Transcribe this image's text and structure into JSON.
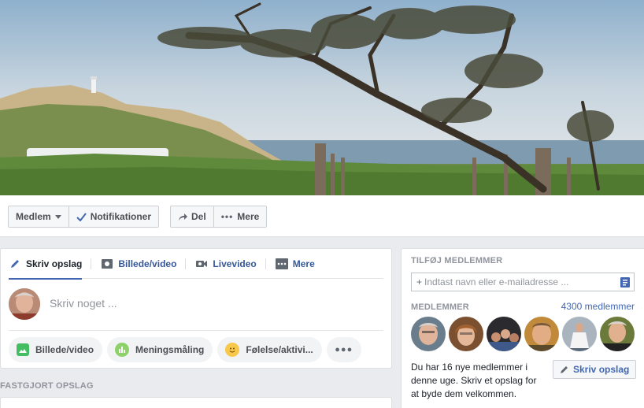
{
  "action_bar": {
    "member_label": "Medlem",
    "notifications_label": "Notifikationer",
    "share_label": "Del",
    "more_label": "Mere"
  },
  "composer": {
    "tabs": [
      {
        "label": "Skriv opslag",
        "icon": "pencil-icon"
      },
      {
        "label": "Billede/video",
        "icon": "photo-icon"
      },
      {
        "label": "Livevideo",
        "icon": "video-camera-icon"
      },
      {
        "label": "Mere",
        "icon": "more-dots-icon"
      }
    ],
    "placeholder": "Skriv noget ...",
    "pills": [
      {
        "label": "Billede/video",
        "icon": "photo-icon",
        "color": "#45bd62"
      },
      {
        "label": "Meningsmåling",
        "icon": "poll-icon",
        "color": "#8ed16b"
      },
      {
        "label": "Følelse/aktivi...",
        "icon": "smiley-icon",
        "color": "#f7c84a"
      }
    ]
  },
  "pinned": {
    "label": "FASTGJORT OPSLAG"
  },
  "members_panel": {
    "add_label": "TILFØJ MEDLEMMER",
    "invite_placeholder": "Indtast navn eller e-mailadresse ...",
    "members_label": "MEDLEMMER",
    "members_count": "4300 medlemmer",
    "welcome_text": "Du har 16 nye medlemmer i denne uge. Skriv et opslag for at byde dem velkommen.",
    "write_post_label": "Skriv opslag"
  },
  "colors": {
    "accent": "#4267b2",
    "background": "#e9ebee",
    "muted": "#90949c"
  }
}
